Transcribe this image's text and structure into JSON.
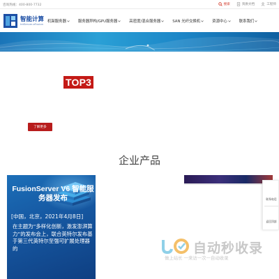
{
  "topbar": {
    "hotline": "咨询热线：400-800-7732",
    "links": [
      {
        "label": "搜索",
        "icon": "search-icon"
      },
      {
        "label": "资质文档",
        "icon": "document-icon"
      },
      {
        "label": "工程师",
        "icon": "user-icon"
      }
    ],
    "accent": "#d23a2a"
  },
  "logo": {
    "name_cn": "智能计算",
    "name_en": "IntServer-eFusion"
  },
  "nav": {
    "items": [
      {
        "label": "机架服务器"
      },
      {
        "label": "服务器异构/GPU服务器"
      },
      {
        "label": "高密度/混合服务器"
      },
      {
        "label": "SAN 光纤交换机"
      },
      {
        "label": "资源中心"
      },
      {
        "label": "联系我们"
      }
    ]
  },
  "hero": {
    "badge": "TOP3",
    "learn_more": "了解更多"
  },
  "products": {
    "section_title": "企业产品",
    "featured": {
      "title": "FusionServer V6 智能服务器发布",
      "date": "[中国，北京，2021年4月8日]",
      "body": "在主题为“多样化创新，激发澎湃算力”的发布会上，联合英特尔发布基于第三代英特尔至强可扩展处理器的"
    }
  },
  "side_panel": {
    "items": [
      {
        "label": "联系电话"
      },
      {
        "label": "返回顶部"
      }
    ]
  },
  "watermark": {
    "name": "自动秒收录",
    "slogan": "做上站长 一来访一次一自动收录"
  },
  "colors": {
    "brand_blue": "#1d4fa5",
    "brand_red": "#c41a16",
    "banner_blue": "#1c86c7"
  }
}
